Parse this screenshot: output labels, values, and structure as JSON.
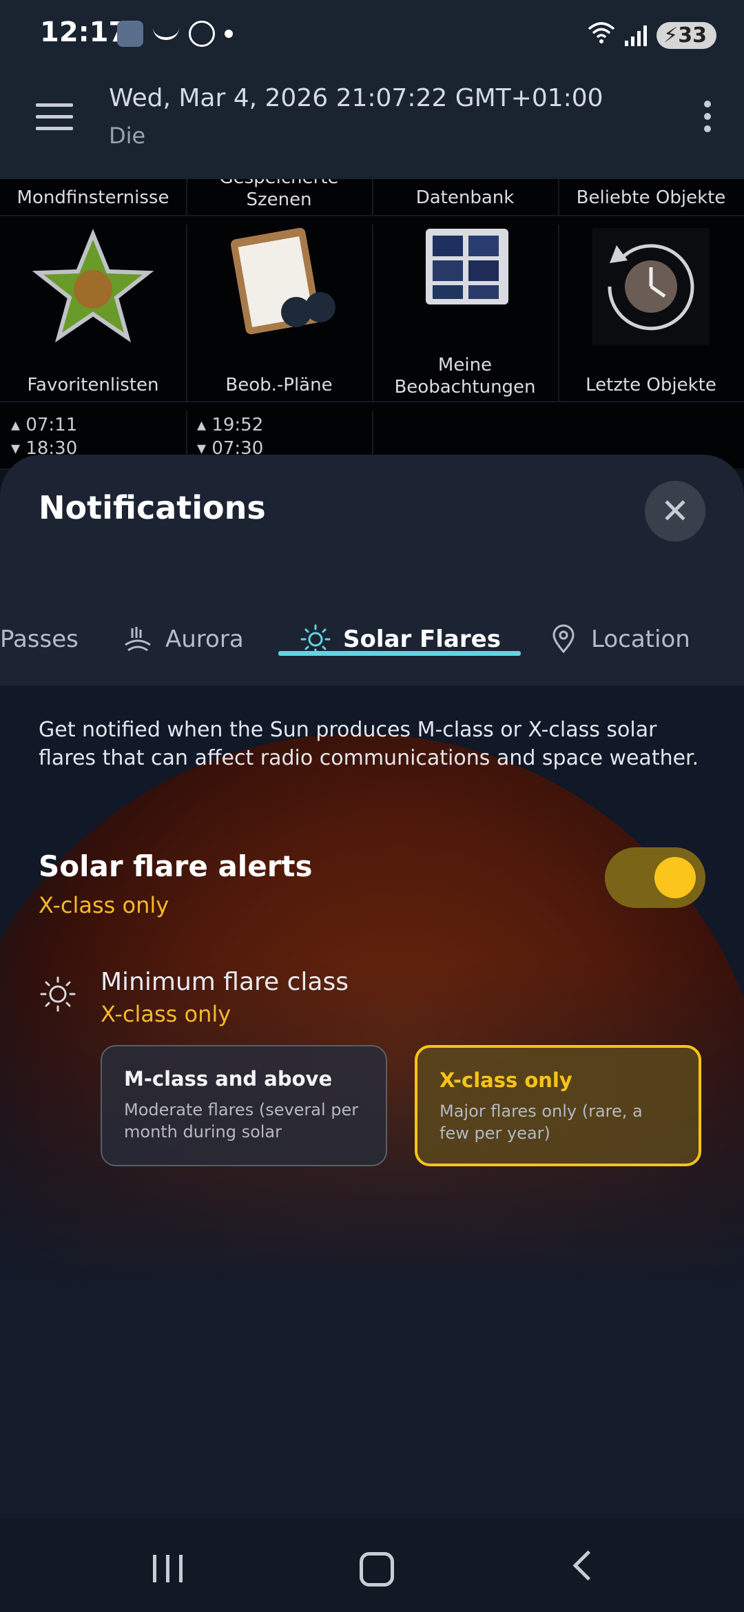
{
  "status_bar": {
    "time": "12:17",
    "battery": "33"
  },
  "app_bar": {
    "title": "Wed, Mar 4, 2026 21:07:22 GMT+01:00",
    "subtitle": "Die"
  },
  "grid": {
    "row1": [
      "Mondfinsternisse",
      "Gespeicherte Szenen",
      "Datenbank",
      "Beliebte Objekte"
    ],
    "row2": [
      "Favoritenlisten",
      "Beob.-Pläne",
      "Meine Beobachtungen",
      "Letzte Objekte"
    ],
    "times": [
      {
        "rise": "07:11",
        "set": "18:30"
      },
      {
        "rise": "19:52",
        "set": "07:30"
      }
    ]
  },
  "sheet": {
    "title": "Notifications",
    "tabs": [
      {
        "label": "Passes",
        "icon": "satellite-icon"
      },
      {
        "label": "Aurora",
        "icon": "aurora-icon"
      },
      {
        "label": "Solar Flares",
        "icon": "sun-icon",
        "active": true
      },
      {
        "label": "Location",
        "icon": "location-pin-icon"
      }
    ],
    "description": "Get notified when the Sun produces M-class or X-class solar flares that can affect radio communications and space weather.",
    "alert": {
      "title": "Solar flare alerts",
      "subtitle": "X-class only",
      "enabled": true
    },
    "min_class": {
      "title": "Minimum flare class",
      "value": "X-class only",
      "options": [
        {
          "title": "M-class and above",
          "desc": "Moderate flares (several per month during solar",
          "selected": false
        },
        {
          "title": "X-class only",
          "desc": "Major flares only (rare, a few per year)",
          "selected": true
        }
      ]
    }
  },
  "colors": {
    "accent_tab": "#5fd6e2",
    "accent_yellow": "#f6c419"
  }
}
